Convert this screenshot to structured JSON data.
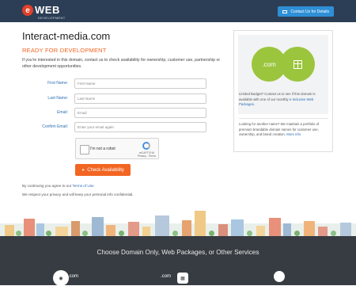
{
  "header": {
    "logo_letter": "e",
    "logo_text": "WEB",
    "logo_sub": "DEVELOPMENT",
    "contact_label": "Contact Us for Details"
  },
  "main": {
    "domain": "Interact-media.com",
    "status": "READY FOR DEVELOPMENT",
    "intro": "If you're interested in this domain, contact us to check availability for ownership, customer use, partnership or other development opportunities."
  },
  "form": {
    "first_name": {
      "label": "First Name:",
      "placeholder": "First Name",
      "value": ""
    },
    "last_name": {
      "label": "Last Name:",
      "placeholder": "Last Name",
      "value": ""
    },
    "email": {
      "label": "Email:",
      "placeholder": "Email",
      "value": ""
    },
    "confirm_email": {
      "label": "Confirm Email:",
      "placeholder": "Enter your email again",
      "value": ""
    },
    "captcha_text": "I'm not a robot",
    "captcha_brand": "reCAPTCHA",
    "captcha_links": "Privacy - Terms",
    "submit_label": "Check Availability",
    "terms_prefix": "By continuing you agree to our ",
    "terms_link": "Terms of Use",
    "privacy_note": "We respect your privacy and will keep your personal info confidential."
  },
  "panel": {
    "badge_text": ".com",
    "text1_before": "Limited Budget? Contact us to see if this domain is available with one of our monthly ",
    "text1_link": "e-Inclusive Web Packages",
    "text1_after": ".",
    "text2": "Looking for another name? We maintain a portfolio of premium brandable domain names for customer use, ownership, and brand creation. ",
    "text2_link": "More info"
  },
  "footer": {
    "title": "Choose Domain Only, Web Packages, or Other Services",
    "icon1_label": ".com",
    "icon2_label": ".com"
  },
  "colors": {
    "header_bg": "#2c3e55",
    "accent_orange": "#f26522",
    "accent_blue": "#2e8fd6",
    "panel_green": "#9bc53d",
    "footer_bg": "#373c42"
  }
}
